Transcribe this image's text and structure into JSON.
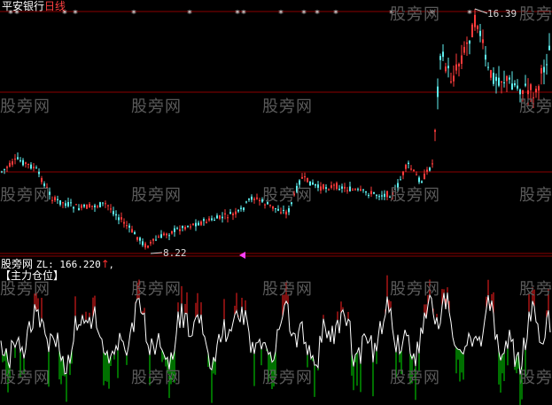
{
  "header": {
    "stock_name": "平安银行",
    "period": "日线",
    "colors": {
      "stock_name": "#ffffff",
      "period": "#ff4040"
    }
  },
  "main_chart": {
    "high_label": "16.39",
    "low_label": "8.22"
  },
  "indicator": {
    "source_label": "股旁网",
    "value_text": "ZL: 166.220",
    "arrow": "↑",
    "trailing": ",",
    "panel_title": "【主力仓位】",
    "colors": {
      "source_label": "#ffffff",
      "value": "#ffffff",
      "arrow": "#ff3030",
      "title": "#ffffff"
    }
  },
  "watermark": "股旁网",
  "colors": {
    "background": "#000000",
    "up_candle": "#ff3b3b",
    "down_candle": "#5ff0f0",
    "grid_line": "#8b0000",
    "signal_star": "#ffffff",
    "histogram_up": "#ff2020",
    "histogram_down": "#00e000",
    "indicator_line": "#ffffff",
    "marker": "#ff40ff"
  }
}
